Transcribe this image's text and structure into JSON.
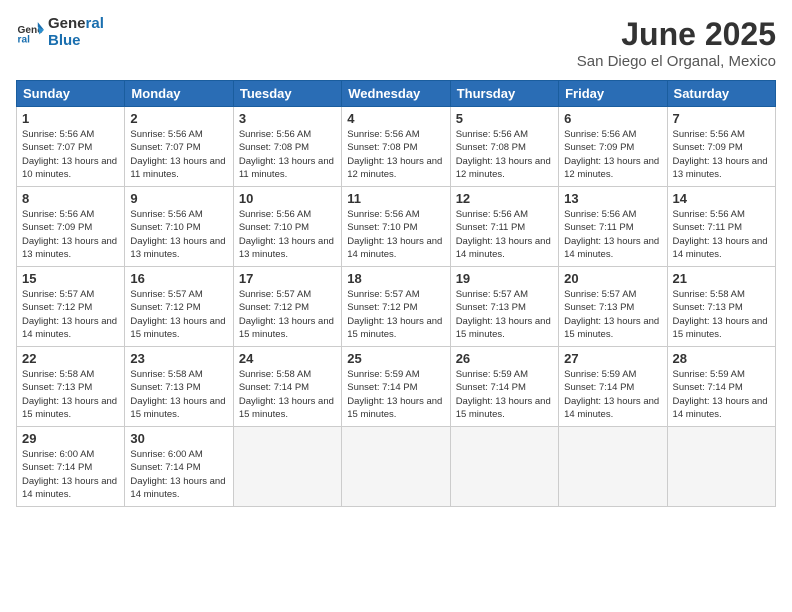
{
  "logo": {
    "general": "General",
    "blue": "Blue"
  },
  "title": "June 2025",
  "subtitle": "San Diego el Organal, Mexico",
  "days_header": [
    "Sunday",
    "Monday",
    "Tuesday",
    "Wednesday",
    "Thursday",
    "Friday",
    "Saturday"
  ],
  "weeks": [
    [
      {
        "day": "1",
        "info": "Sunrise: 5:56 AM\nSunset: 7:07 PM\nDaylight: 13 hours and 10 minutes."
      },
      {
        "day": "2",
        "info": "Sunrise: 5:56 AM\nSunset: 7:07 PM\nDaylight: 13 hours and 11 minutes."
      },
      {
        "day": "3",
        "info": "Sunrise: 5:56 AM\nSunset: 7:08 PM\nDaylight: 13 hours and 11 minutes."
      },
      {
        "day": "4",
        "info": "Sunrise: 5:56 AM\nSunset: 7:08 PM\nDaylight: 13 hours and 12 minutes."
      },
      {
        "day": "5",
        "info": "Sunrise: 5:56 AM\nSunset: 7:08 PM\nDaylight: 13 hours and 12 minutes."
      },
      {
        "day": "6",
        "info": "Sunrise: 5:56 AM\nSunset: 7:09 PM\nDaylight: 13 hours and 12 minutes."
      },
      {
        "day": "7",
        "info": "Sunrise: 5:56 AM\nSunset: 7:09 PM\nDaylight: 13 hours and 13 minutes."
      }
    ],
    [
      {
        "day": "8",
        "info": "Sunrise: 5:56 AM\nSunset: 7:09 PM\nDaylight: 13 hours and 13 minutes."
      },
      {
        "day": "9",
        "info": "Sunrise: 5:56 AM\nSunset: 7:10 PM\nDaylight: 13 hours and 13 minutes."
      },
      {
        "day": "10",
        "info": "Sunrise: 5:56 AM\nSunset: 7:10 PM\nDaylight: 13 hours and 13 minutes."
      },
      {
        "day": "11",
        "info": "Sunrise: 5:56 AM\nSunset: 7:10 PM\nDaylight: 13 hours and 14 minutes."
      },
      {
        "day": "12",
        "info": "Sunrise: 5:56 AM\nSunset: 7:11 PM\nDaylight: 13 hours and 14 minutes."
      },
      {
        "day": "13",
        "info": "Sunrise: 5:56 AM\nSunset: 7:11 PM\nDaylight: 13 hours and 14 minutes."
      },
      {
        "day": "14",
        "info": "Sunrise: 5:56 AM\nSunset: 7:11 PM\nDaylight: 13 hours and 14 minutes."
      }
    ],
    [
      {
        "day": "15",
        "info": "Sunrise: 5:57 AM\nSunset: 7:12 PM\nDaylight: 13 hours and 14 minutes."
      },
      {
        "day": "16",
        "info": "Sunrise: 5:57 AM\nSunset: 7:12 PM\nDaylight: 13 hours and 15 minutes."
      },
      {
        "day": "17",
        "info": "Sunrise: 5:57 AM\nSunset: 7:12 PM\nDaylight: 13 hours and 15 minutes."
      },
      {
        "day": "18",
        "info": "Sunrise: 5:57 AM\nSunset: 7:12 PM\nDaylight: 13 hours and 15 minutes."
      },
      {
        "day": "19",
        "info": "Sunrise: 5:57 AM\nSunset: 7:13 PM\nDaylight: 13 hours and 15 minutes."
      },
      {
        "day": "20",
        "info": "Sunrise: 5:57 AM\nSunset: 7:13 PM\nDaylight: 13 hours and 15 minutes."
      },
      {
        "day": "21",
        "info": "Sunrise: 5:58 AM\nSunset: 7:13 PM\nDaylight: 13 hours and 15 minutes."
      }
    ],
    [
      {
        "day": "22",
        "info": "Sunrise: 5:58 AM\nSunset: 7:13 PM\nDaylight: 13 hours and 15 minutes."
      },
      {
        "day": "23",
        "info": "Sunrise: 5:58 AM\nSunset: 7:13 PM\nDaylight: 13 hours and 15 minutes."
      },
      {
        "day": "24",
        "info": "Sunrise: 5:58 AM\nSunset: 7:14 PM\nDaylight: 13 hours and 15 minutes."
      },
      {
        "day": "25",
        "info": "Sunrise: 5:59 AM\nSunset: 7:14 PM\nDaylight: 13 hours and 15 minutes."
      },
      {
        "day": "26",
        "info": "Sunrise: 5:59 AM\nSunset: 7:14 PM\nDaylight: 13 hours and 15 minutes."
      },
      {
        "day": "27",
        "info": "Sunrise: 5:59 AM\nSunset: 7:14 PM\nDaylight: 13 hours and 14 minutes."
      },
      {
        "day": "28",
        "info": "Sunrise: 5:59 AM\nSunset: 7:14 PM\nDaylight: 13 hours and 14 minutes."
      }
    ],
    [
      {
        "day": "29",
        "info": "Sunrise: 6:00 AM\nSunset: 7:14 PM\nDaylight: 13 hours and 14 minutes."
      },
      {
        "day": "30",
        "info": "Sunrise: 6:00 AM\nSunset: 7:14 PM\nDaylight: 13 hours and 14 minutes."
      },
      {
        "day": "",
        "info": ""
      },
      {
        "day": "",
        "info": ""
      },
      {
        "day": "",
        "info": ""
      },
      {
        "day": "",
        "info": ""
      },
      {
        "day": "",
        "info": ""
      }
    ]
  ]
}
